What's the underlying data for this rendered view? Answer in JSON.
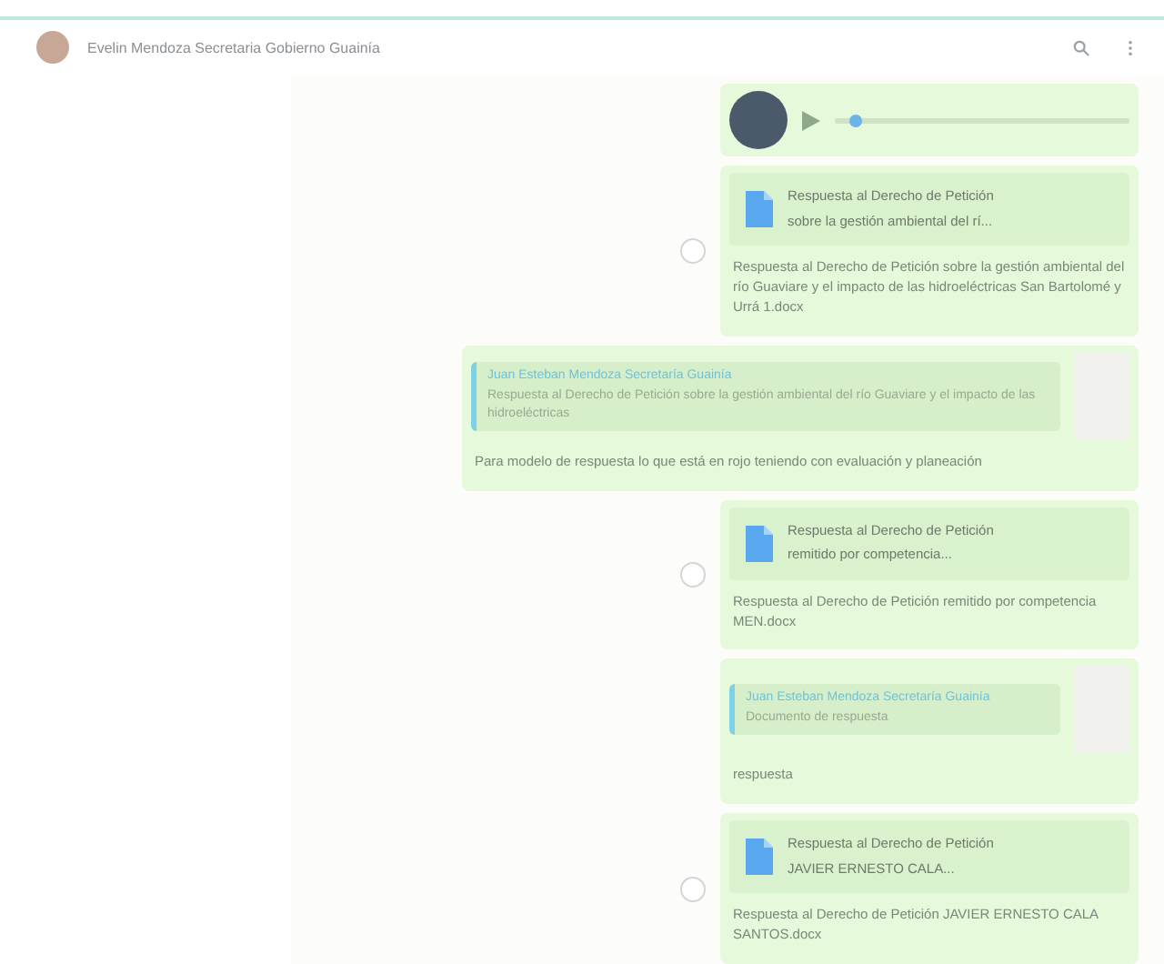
{
  "header": {
    "title": "Evelin Mendoza Secretaria Gobierno Guainía"
  },
  "messages": [
    {
      "kind": "audio",
      "forward": false,
      "level": 0.05
    },
    {
      "kind": "document",
      "forward": true,
      "doc_title": "Respuesta al Derecho de Petición",
      "doc_subtitle": "sobre la gestión ambiental del rí...",
      "caption": "Respuesta al Derecho de Petición sobre la gestión ambiental del río Guaviare y el impacto de las hidroeléctricas San Bartolomé y Urrá 1.docx"
    },
    {
      "kind": "quoted",
      "forward": false,
      "quote_author": "Juan Esteban Mendoza Secretaría Guainía",
      "quote_text": "Respuesta al Derecho de Petición sobre la gestión ambiental del río Guaviare y el impacto de las hidroeléctricas",
      "caption": "Para modelo de respuesta lo que está en rojo teniendo con evaluación y planeación"
    },
    {
      "kind": "document",
      "forward": true,
      "doc_title": "Respuesta al Derecho de Petición",
      "doc_subtitle": "remitido por competencia...",
      "caption": "Respuesta al Derecho de Petición remitido por competencia MEN.docx"
    },
    {
      "kind": "quoted",
      "forward": false,
      "quote_author": "Juan Esteban Mendoza Secretaría Guainía",
      "quote_text": "Documento de respuesta",
      "caption": "respuesta"
    },
    {
      "kind": "document",
      "forward": true,
      "doc_title": "Respuesta al Derecho de Petición",
      "doc_subtitle": "JAVIER ERNESTO CALA...",
      "caption": "Respuesta al Derecho de Petición JAVIER ERNESTO CALA SANTOS.docx"
    }
  ]
}
